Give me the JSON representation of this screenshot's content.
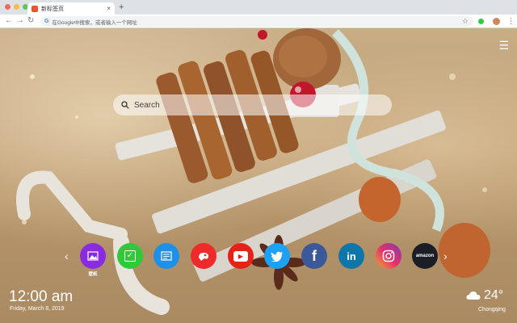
{
  "browser": {
    "tab_title": "新标签页",
    "tab_close": "×",
    "new_tab": "+",
    "back": "←",
    "forward": "→",
    "reload": "↻",
    "omnibox_placeholder": "在Google中搜索，或者输入一个网址",
    "bookmark_star": "☆",
    "menu": "⋮",
    "window_dots": [
      "#ee6a5f",
      "#f5bd4f",
      "#61c454"
    ]
  },
  "page": {
    "menu_icon": "☰",
    "search": {
      "placeholder": "Search"
    },
    "shortcuts": {
      "prev": "‹",
      "next": "›",
      "items": [
        {
          "name": "gallery",
          "color": "#8a2be2",
          "glyph": "",
          "label": "壁纸"
        },
        {
          "name": "check",
          "color": "#2fc93a",
          "glyph": "✓",
          "label": ""
        },
        {
          "name": "news",
          "color": "#1e90e8",
          "glyph": "",
          "label": ""
        },
        {
          "name": "game",
          "color": "#ee2a2a",
          "glyph": "",
          "label": ""
        },
        {
          "name": "youtube",
          "color": "#e62117",
          "glyph": "▶",
          "label": ""
        },
        {
          "name": "twitter",
          "color": "#1da1f2",
          "glyph": "",
          "label": ""
        },
        {
          "name": "facebook",
          "color": "#3b5998",
          "glyph": "f",
          "label": ""
        },
        {
          "name": "linkedin",
          "color": "#0e76a8",
          "glyph": "in",
          "label": ""
        },
        {
          "name": "instagram",
          "color": "#c13584",
          "glyph": "",
          "label": ""
        },
        {
          "name": "amazon",
          "color": "#1b1f25",
          "glyph": "amazon",
          "label": ""
        }
      ]
    },
    "clock": {
      "time": "12:00 am",
      "date": "Friday, March 8, 2019"
    },
    "weather": {
      "temp": "24°",
      "city": "Chongqing",
      "icon": "cloud-icon"
    }
  }
}
